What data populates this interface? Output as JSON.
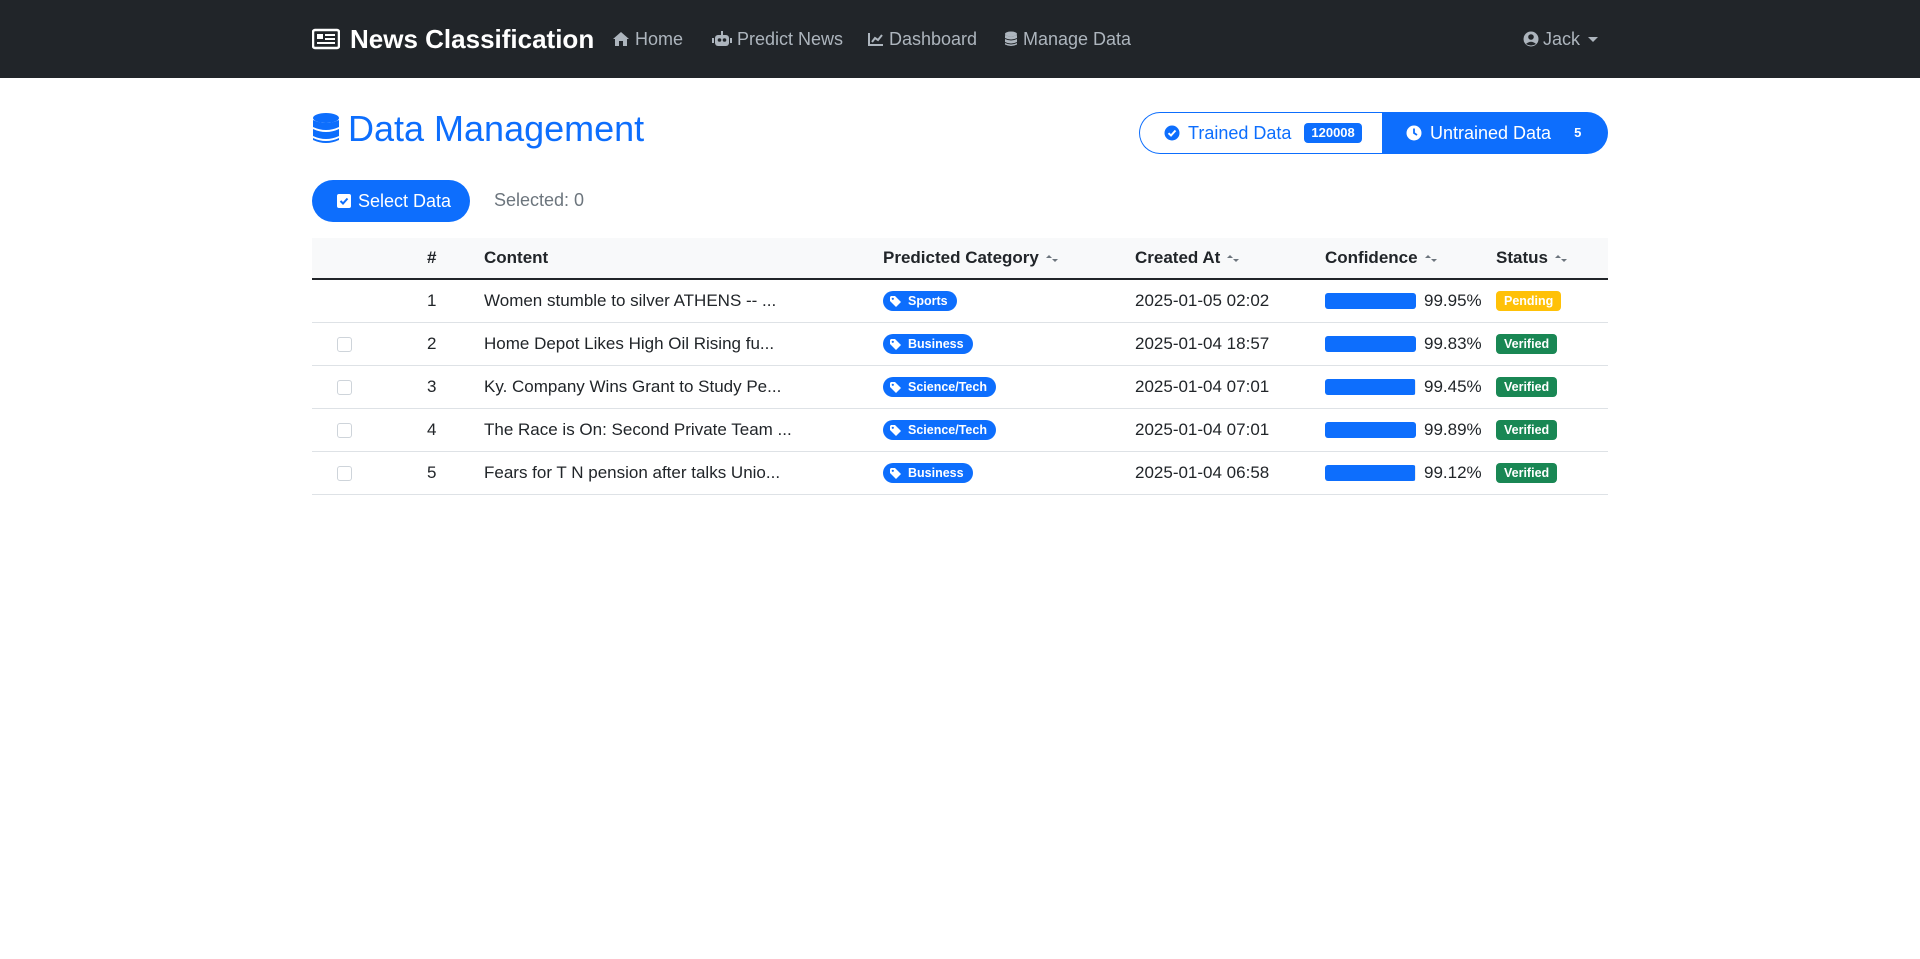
{
  "navbar": {
    "brand": "News Classification",
    "items": [
      {
        "label": "Home",
        "icon": "home-icon"
      },
      {
        "label": "Predict News",
        "icon": "robot-icon"
      },
      {
        "label": "Dashboard",
        "icon": "chart-line-icon"
      },
      {
        "label": "Manage Data",
        "icon": "database-icon"
      }
    ],
    "user": "Jack"
  },
  "page": {
    "title": "Data Management",
    "tabs": {
      "trained": {
        "label": "Trained Data",
        "count": "120008"
      },
      "untrained": {
        "label": "Untrained Data",
        "count": "5"
      }
    },
    "select_button": "Select Data",
    "selected_text": "Selected: 0"
  },
  "table": {
    "headers": {
      "num": "#",
      "content": "Content",
      "category": "Predicted Category",
      "created": "Created At",
      "confidence": "Confidence",
      "status": "Status"
    },
    "rows": [
      {
        "num": "1",
        "content": "Women stumble to silver ATHENS -- ...",
        "category": "Sports",
        "created": "2025-01-05 02:02",
        "confidence": "99.95%",
        "confidence_value": 0.9995,
        "status": "Pending",
        "has_checkbox": false
      },
      {
        "num": "2",
        "content": "Home Depot Likes High Oil Rising fu...",
        "category": "Business",
        "created": "2025-01-04 18:57",
        "confidence": "99.83%",
        "confidence_value": 0.9983,
        "status": "Verified",
        "has_checkbox": true
      },
      {
        "num": "3",
        "content": "Ky. Company Wins Grant to Study Pe...",
        "category": "Science/Tech",
        "created": "2025-01-04 07:01",
        "confidence": "99.45%",
        "confidence_value": 0.9945,
        "status": "Verified",
        "has_checkbox": true
      },
      {
        "num": "4",
        "content": "The Race is On: Second Private Team ...",
        "category": "Science/Tech",
        "created": "2025-01-04 07:01",
        "confidence": "99.89%",
        "confidence_value": 0.9989,
        "status": "Verified",
        "has_checkbox": true
      },
      {
        "num": "5",
        "content": "Fears for T N pension after talks Unio...",
        "category": "Business",
        "created": "2025-01-04 06:58",
        "confidence": "99.12%",
        "confidence_value": 0.9912,
        "status": "Verified",
        "has_checkbox": true
      }
    ]
  },
  "colors": {
    "primary": "#0d6efd",
    "navbar": "#212529",
    "pending": "#ffc107",
    "verified": "#198754"
  }
}
